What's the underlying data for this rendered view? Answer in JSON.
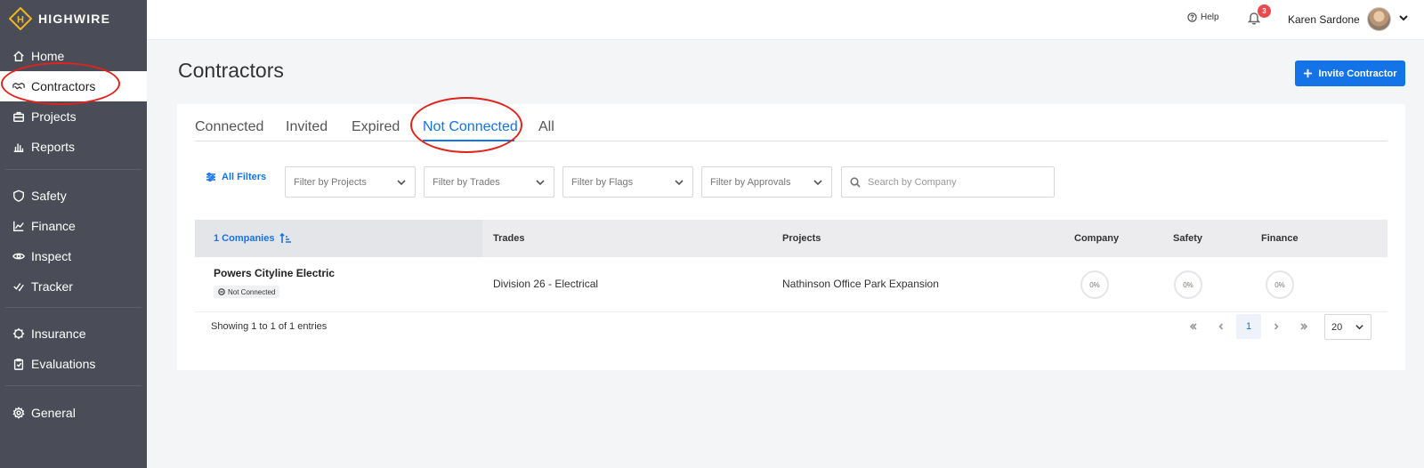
{
  "app": {
    "brand": "HIGHWIRE",
    "logo_letter": "H"
  },
  "sidebar": {
    "items": [
      {
        "label": "Home",
        "icon": "home-icon"
      },
      {
        "label": "Contractors",
        "icon": "handshake-icon",
        "active": true
      },
      {
        "label": "Projects",
        "icon": "briefcase-icon"
      },
      {
        "label": "Reports",
        "icon": "bar-chart-icon"
      },
      {
        "label": "Safety",
        "icon": "shield-icon"
      },
      {
        "label": "Finance",
        "icon": "line-chart-icon"
      },
      {
        "label": "Inspect",
        "icon": "eye-icon"
      },
      {
        "label": "Tracker",
        "icon": "check-list-icon"
      },
      {
        "label": "Insurance",
        "icon": "umbrella-icon"
      },
      {
        "label": "Evaluations",
        "icon": "clipboard-icon"
      },
      {
        "label": "General",
        "icon": "gear-icon"
      }
    ]
  },
  "header": {
    "help_label": "Help",
    "notification_count": "3",
    "user_name": "Karen Sardone"
  },
  "page": {
    "title": "Contractors",
    "invite_label": "Invite Contractor"
  },
  "tabs": [
    {
      "label": "Connected"
    },
    {
      "label": "Invited"
    },
    {
      "label": "Expired"
    },
    {
      "label": "Not Connected",
      "active": true
    },
    {
      "label": "All"
    }
  ],
  "filters": {
    "all_filters_label": "All Filters",
    "projects": "Filter by Projects",
    "trades": "Filter by Trades",
    "flags": "Filter by Flags",
    "approvals": "Filter by Approvals",
    "search_placeholder": "Search by Company"
  },
  "table": {
    "columns": {
      "companies": "1 Companies",
      "trades": "Trades",
      "projects": "Projects",
      "company": "Company",
      "safety": "Safety",
      "finance": "Finance"
    },
    "rows": [
      {
        "company": "Powers Cityline Electric",
        "status": "Not Connected",
        "trades": "Division 26 - Electrical",
        "projects": "Nathinson Office Park Expansion",
        "company_score": "0%",
        "safety_score": "0%",
        "finance_score": "0%"
      }
    ]
  },
  "pagination": {
    "showing": "Showing 1 to 1 of 1 entries",
    "current_page": "1",
    "page_size": "20"
  },
  "colors": {
    "accent": "#1473e6",
    "sidebar_bg": "#4a4d57",
    "annotation": "#e0241b",
    "badge": "#e84b4b"
  }
}
